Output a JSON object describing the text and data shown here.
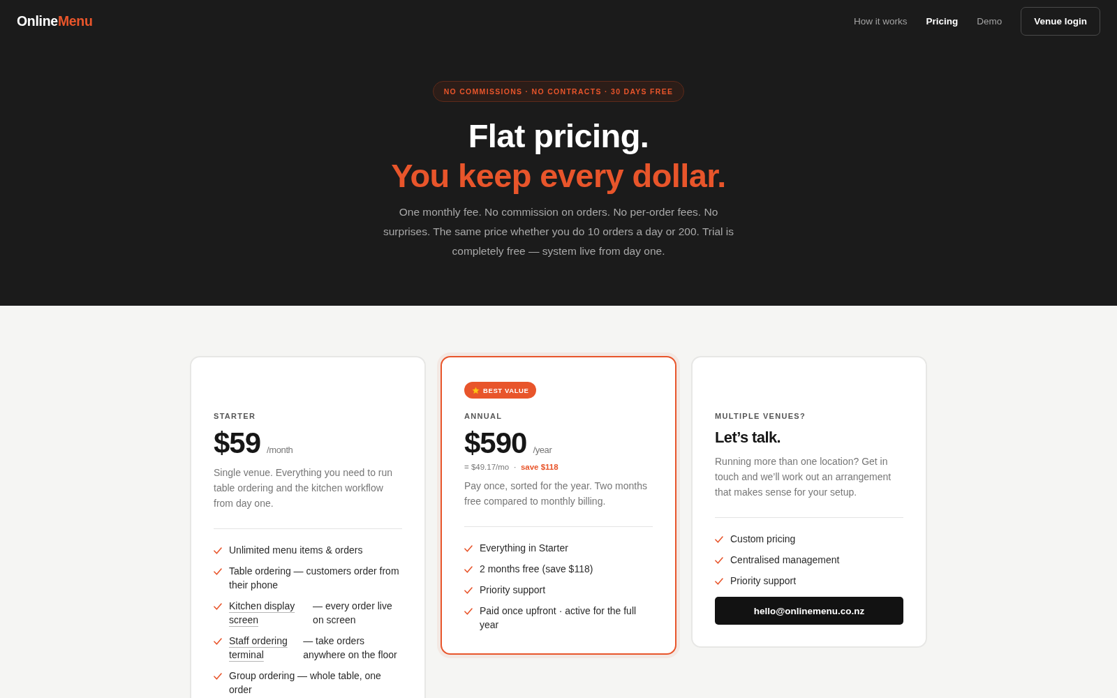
{
  "header": {
    "logo": {
      "primary": "Online",
      "accent": "Menu"
    },
    "nav": [
      {
        "label": "How it works",
        "selected": false
      },
      {
        "label": "Pricing",
        "selected": true
      },
      {
        "label": "Demo",
        "selected": false
      }
    ],
    "login_button": "Venue login"
  },
  "hero": {
    "badge": "NO COMMISSIONS · NO CONTRACTS · 30 DAYS FREE",
    "title": "Flat pricing.",
    "title_accent": "You keep every dollar.",
    "subtitle": "One monthly fee. No commission on orders. No per-order fees. No surprises. The same price whether you do 10 orders a day or 200. Trial is completely free — system live from day one."
  },
  "plans": [
    {
      "kind": "price",
      "featured": false,
      "label": "STARTER",
      "price": "$59",
      "period": "/month",
      "description": "Single venue. Everything you need to run table ordering and the kitchen workflow from day one.",
      "features": [
        {
          "kind": "plain",
          "text": "Unlimited menu items & orders"
        },
        {
          "kind": "plain",
          "text": "Table ordering — customers order from their phone"
        },
        {
          "kind": "link",
          "link": "Kitchen display screen",
          "text": "— every order live on screen"
        },
        {
          "kind": "link",
          "link": "Staff ordering terminal",
          "text": "— take orders anywhere on the floor"
        },
        {
          "kind": "plain",
          "text": "Group ordering — whole table, one order"
        }
      ]
    },
    {
      "kind": "price",
      "featured": true,
      "ribbon": "BEST VALUE",
      "label": "ANNUAL",
      "price": "$590",
      "period": "/year",
      "note": "= $49.17/mo  ·  **save $118**",
      "description": "Pay once, sorted for the year. Two months free compared to monthly billing.",
      "features": [
        {
          "kind": "plain",
          "text": "Everything in Starter"
        },
        {
          "kind": "plain",
          "text": "2 months free (save $118)"
        },
        {
          "kind": "plain",
          "text": "Priority support"
        },
        {
          "kind": "plain",
          "text": "Paid once upfront · active for the full year"
        }
      ]
    },
    {
      "kind": "contact",
      "featured": false,
      "label": "MULTIPLE VENUES?",
      "heading": "Let’s talk.",
      "description": "Running more than one location? Get in touch and we’ll work out an arrangement that makes sense for your setup.",
      "features": [
        {
          "kind": "plain",
          "text": "Custom pricing"
        },
        {
          "kind": "plain",
          "text": "Centralised management"
        },
        {
          "kind": "plain",
          "text": "Priority support"
        }
      ],
      "button": "hello@onlinemenu.co.nz"
    }
  ]
}
